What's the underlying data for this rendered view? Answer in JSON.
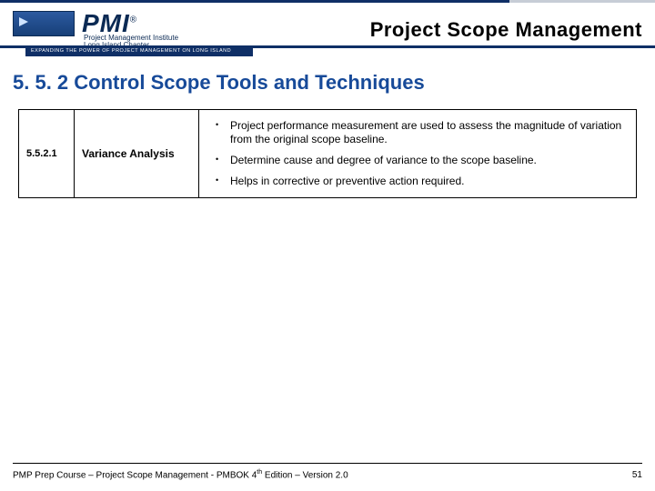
{
  "header": {
    "logo_mark_label": "PMI logo",
    "logo_text": "PMI",
    "logo_reg": "®",
    "logo_sub_line1": "Project Management Institute",
    "logo_sub_line2": "Long Island Chapter",
    "tagline": "EXPANDING THE POWER OF PROJECT MANAGEMENT ON LONG ISLAND",
    "slide_title": "Project Scope Management"
  },
  "section": {
    "heading": "5. 5. 2 Control Scope Tools and Techniques"
  },
  "table": {
    "row": {
      "num": "5.5.2.1",
      "name": "Variance Analysis",
      "bullets": [
        "Project performance measurement are used to assess the magnitude of variation from the original scope baseline.",
        "Determine cause and degree of variance to the scope baseline.",
        "Helps in corrective or preventive action required."
      ]
    }
  },
  "footer": {
    "left_pre": "PMP Prep Course – Project Scope Management - PMBOK 4",
    "left_sup": "th",
    "left_post": " Edition – Version 2.0",
    "page": "51"
  }
}
